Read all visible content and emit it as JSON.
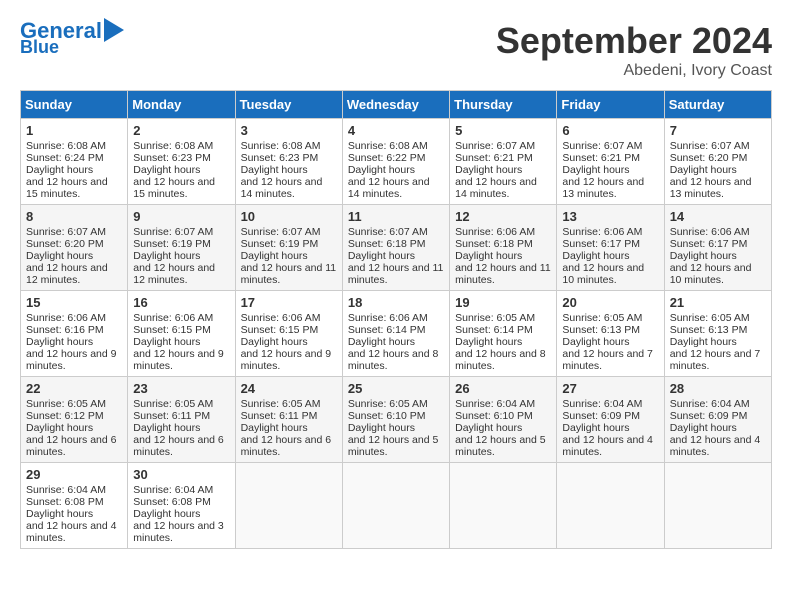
{
  "header": {
    "logo_line1": "General",
    "logo_line2": "Blue",
    "month": "September 2024",
    "location": "Abedeni, Ivory Coast"
  },
  "weekdays": [
    "Sunday",
    "Monday",
    "Tuesday",
    "Wednesday",
    "Thursday",
    "Friday",
    "Saturday"
  ],
  "weeks": [
    [
      {
        "day": "1",
        "sunrise": "6:08 AM",
        "sunset": "6:24 PM",
        "daylight": "12 hours and 15 minutes."
      },
      {
        "day": "2",
        "sunrise": "6:08 AM",
        "sunset": "6:23 PM",
        "daylight": "12 hours and 15 minutes."
      },
      {
        "day": "3",
        "sunrise": "6:08 AM",
        "sunset": "6:23 PM",
        "daylight": "12 hours and 14 minutes."
      },
      {
        "day": "4",
        "sunrise": "6:08 AM",
        "sunset": "6:22 PM",
        "daylight": "12 hours and 14 minutes."
      },
      {
        "day": "5",
        "sunrise": "6:07 AM",
        "sunset": "6:21 PM",
        "daylight": "12 hours and 14 minutes."
      },
      {
        "day": "6",
        "sunrise": "6:07 AM",
        "sunset": "6:21 PM",
        "daylight": "12 hours and 13 minutes."
      },
      {
        "day": "7",
        "sunrise": "6:07 AM",
        "sunset": "6:20 PM",
        "daylight": "12 hours and 13 minutes."
      }
    ],
    [
      {
        "day": "8",
        "sunrise": "6:07 AM",
        "sunset": "6:20 PM",
        "daylight": "12 hours and 12 minutes."
      },
      {
        "day": "9",
        "sunrise": "6:07 AM",
        "sunset": "6:19 PM",
        "daylight": "12 hours and 12 minutes."
      },
      {
        "day": "10",
        "sunrise": "6:07 AM",
        "sunset": "6:19 PM",
        "daylight": "12 hours and 11 minutes."
      },
      {
        "day": "11",
        "sunrise": "6:07 AM",
        "sunset": "6:18 PM",
        "daylight": "12 hours and 11 minutes."
      },
      {
        "day": "12",
        "sunrise": "6:06 AM",
        "sunset": "6:18 PM",
        "daylight": "12 hours and 11 minutes."
      },
      {
        "day": "13",
        "sunrise": "6:06 AM",
        "sunset": "6:17 PM",
        "daylight": "12 hours and 10 minutes."
      },
      {
        "day": "14",
        "sunrise": "6:06 AM",
        "sunset": "6:17 PM",
        "daylight": "12 hours and 10 minutes."
      }
    ],
    [
      {
        "day": "15",
        "sunrise": "6:06 AM",
        "sunset": "6:16 PM",
        "daylight": "12 hours and 9 minutes."
      },
      {
        "day": "16",
        "sunrise": "6:06 AM",
        "sunset": "6:15 PM",
        "daylight": "12 hours and 9 minutes."
      },
      {
        "day": "17",
        "sunrise": "6:06 AM",
        "sunset": "6:15 PM",
        "daylight": "12 hours and 9 minutes."
      },
      {
        "day": "18",
        "sunrise": "6:06 AM",
        "sunset": "6:14 PM",
        "daylight": "12 hours and 8 minutes."
      },
      {
        "day": "19",
        "sunrise": "6:05 AM",
        "sunset": "6:14 PM",
        "daylight": "12 hours and 8 minutes."
      },
      {
        "day": "20",
        "sunrise": "6:05 AM",
        "sunset": "6:13 PM",
        "daylight": "12 hours and 7 minutes."
      },
      {
        "day": "21",
        "sunrise": "6:05 AM",
        "sunset": "6:13 PM",
        "daylight": "12 hours and 7 minutes."
      }
    ],
    [
      {
        "day": "22",
        "sunrise": "6:05 AM",
        "sunset": "6:12 PM",
        "daylight": "12 hours and 6 minutes."
      },
      {
        "day": "23",
        "sunrise": "6:05 AM",
        "sunset": "6:11 PM",
        "daylight": "12 hours and 6 minutes."
      },
      {
        "day": "24",
        "sunrise": "6:05 AM",
        "sunset": "6:11 PM",
        "daylight": "12 hours and 6 minutes."
      },
      {
        "day": "25",
        "sunrise": "6:05 AM",
        "sunset": "6:10 PM",
        "daylight": "12 hours and 5 minutes."
      },
      {
        "day": "26",
        "sunrise": "6:04 AM",
        "sunset": "6:10 PM",
        "daylight": "12 hours and 5 minutes."
      },
      {
        "day": "27",
        "sunrise": "6:04 AM",
        "sunset": "6:09 PM",
        "daylight": "12 hours and 4 minutes."
      },
      {
        "day": "28",
        "sunrise": "6:04 AM",
        "sunset": "6:09 PM",
        "daylight": "12 hours and 4 minutes."
      }
    ],
    [
      {
        "day": "29",
        "sunrise": "6:04 AM",
        "sunset": "6:08 PM",
        "daylight": "12 hours and 4 minutes."
      },
      {
        "day": "30",
        "sunrise": "6:04 AM",
        "sunset": "6:08 PM",
        "daylight": "12 hours and 3 minutes."
      },
      null,
      null,
      null,
      null,
      null
    ]
  ]
}
